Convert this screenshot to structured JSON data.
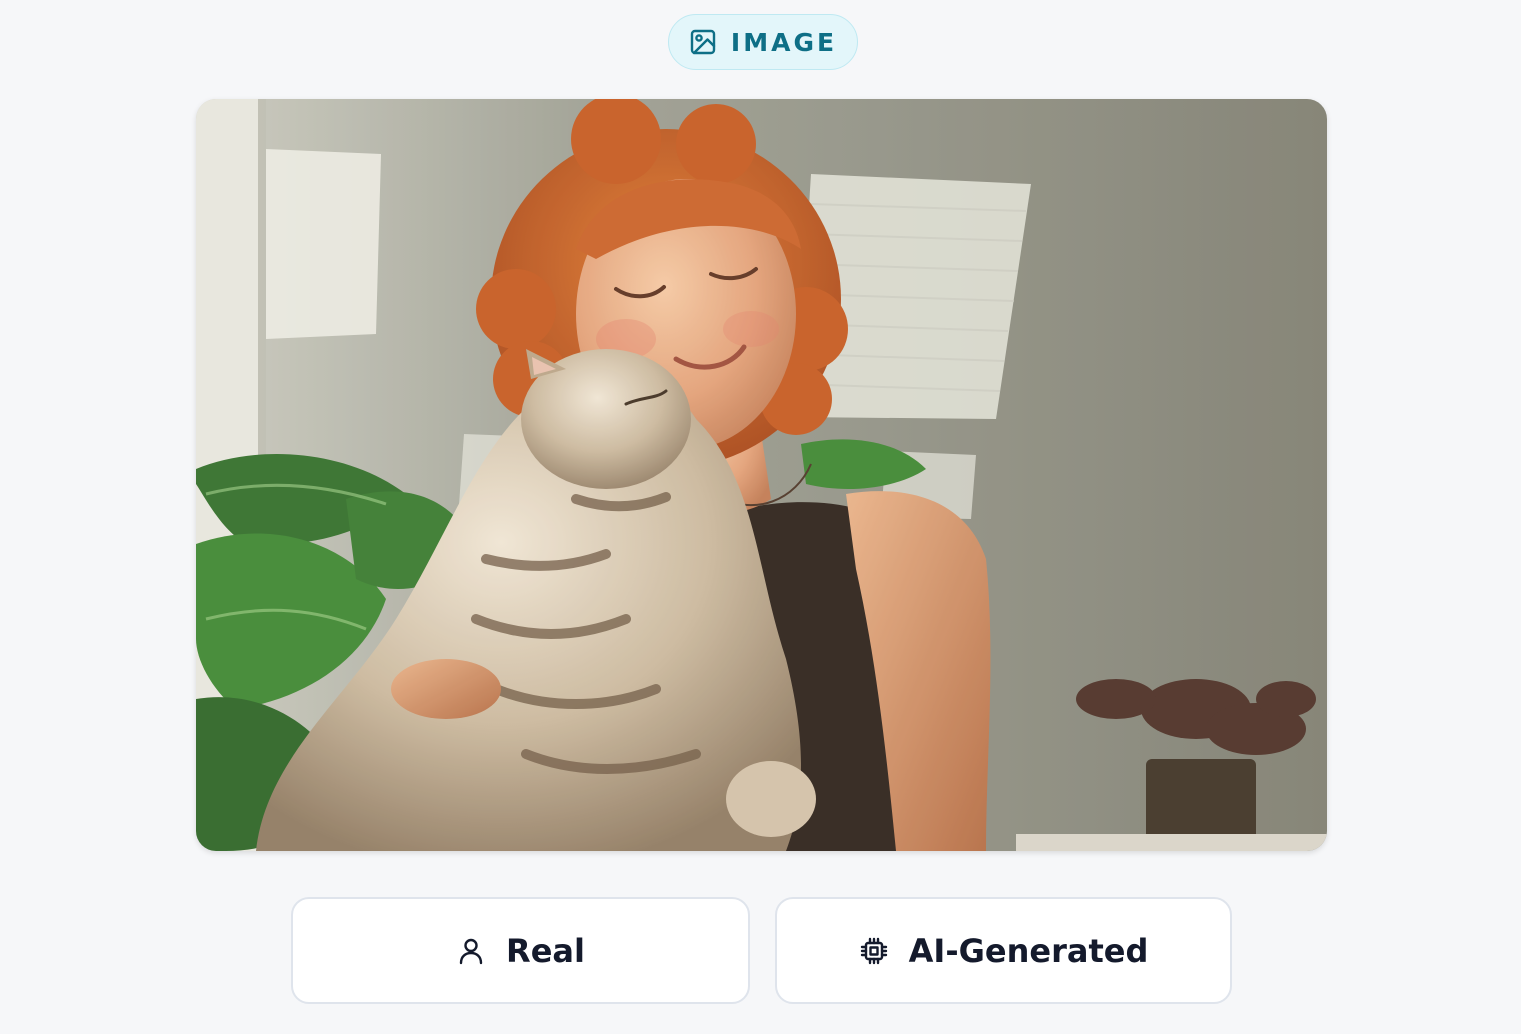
{
  "header": {
    "badge_label": "IMAGE",
    "badge_icon": "image-icon",
    "accent_color": "#0e6f86"
  },
  "main": {
    "photo": {
      "subject": "woman-hugging-cat-photo"
    }
  },
  "choices": [
    {
      "label": "Real",
      "icon": "person-icon"
    },
    {
      "label": "AI-Generated",
      "icon": "chip-icon"
    }
  ]
}
